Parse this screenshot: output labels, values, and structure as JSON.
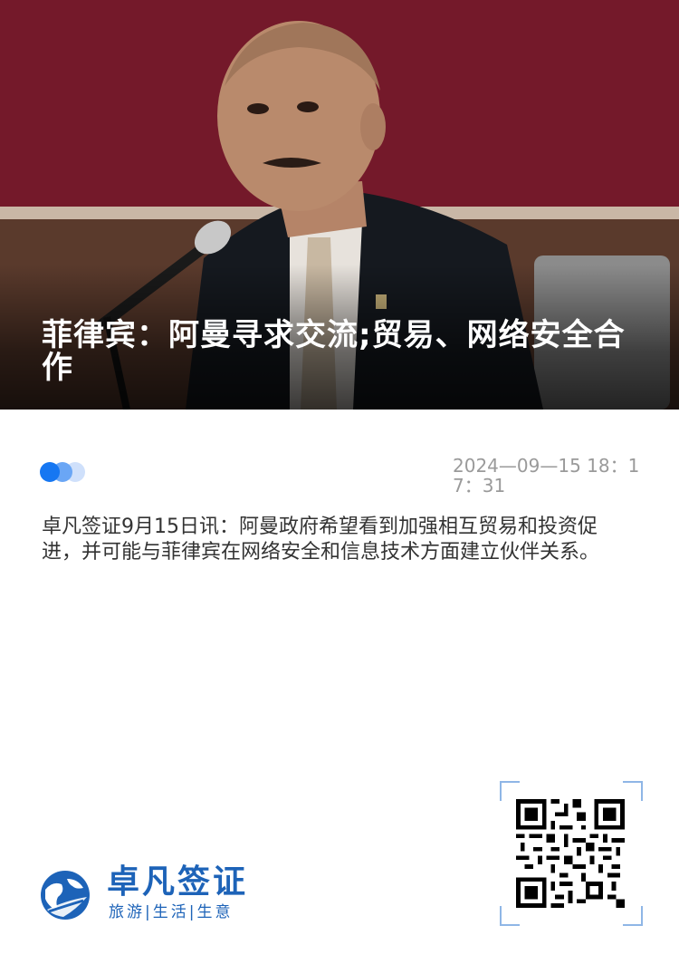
{
  "article": {
    "headline": "菲律宾：阿曼寻求交流;贸易、网络安全合作",
    "timestamp": "2024—09—15  18：17：31",
    "body": "卓凡签证9月15日讯：阿曼政府希望看到加强相互贸易和投资促进，并可能与菲律宾在网络安全和信息技术方面建立伙伴关系。"
  },
  "brand": {
    "name": "卓凡签证",
    "tagline": "旅游|生活|生意",
    "color": "#1d63b8"
  },
  "accent_colors": {
    "dot_primary": "#1677f2",
    "dot_secondary": "#6aa6f5",
    "dot_tertiary": "#cfe0fb",
    "qr_frame": "#8fb6e6"
  },
  "icons": {
    "hero": "photo-man-microphone",
    "logo": "globe-logo-icon",
    "qr": "qr-code-icon",
    "indicator": "carousel-dots-icon"
  }
}
